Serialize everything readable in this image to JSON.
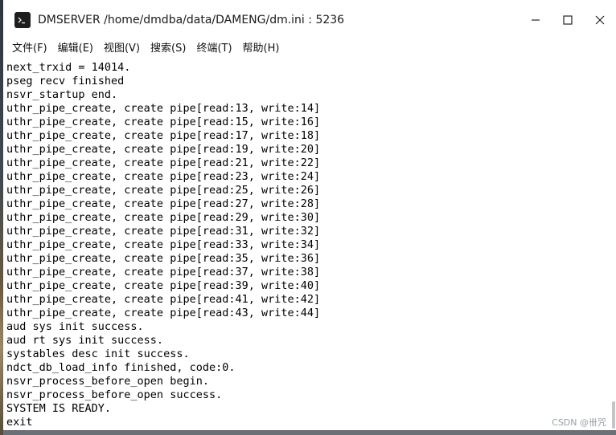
{
  "window": {
    "title": "DMSERVER /home/dmdba/data/DAMENG/dm.ini : 5236",
    "icon": "terminal-icon",
    "controls": {
      "minimize_icon": "minimize-icon",
      "maximize_icon": "maximize-icon",
      "close_icon": "close-icon"
    }
  },
  "menu": [
    {
      "label": "文件(F)"
    },
    {
      "label": "编辑(E)"
    },
    {
      "label": "视图(V)"
    },
    {
      "label": "搜索(S)"
    },
    {
      "label": "终端(T)"
    },
    {
      "label": "帮助(H)"
    }
  ],
  "terminal": {
    "lines": [
      "next_trxid = 14014.",
      "pseg recv finished",
      "nsvr_startup end.",
      "uthr_pipe_create, create pipe[read:13, write:14]",
      "uthr_pipe_create, create pipe[read:15, write:16]",
      "uthr_pipe_create, create pipe[read:17, write:18]",
      "uthr_pipe_create, create pipe[read:19, write:20]",
      "uthr_pipe_create, create pipe[read:21, write:22]",
      "uthr_pipe_create, create pipe[read:23, write:24]",
      "uthr_pipe_create, create pipe[read:25, write:26]",
      "uthr_pipe_create, create pipe[read:27, write:28]",
      "uthr_pipe_create, create pipe[read:29, write:30]",
      "uthr_pipe_create, create pipe[read:31, write:32]",
      "uthr_pipe_create, create pipe[read:33, write:34]",
      "uthr_pipe_create, create pipe[read:35, write:36]",
      "uthr_pipe_create, create pipe[read:37, write:38]",
      "uthr_pipe_create, create pipe[read:39, write:40]",
      "uthr_pipe_create, create pipe[read:41, write:42]",
      "uthr_pipe_create, create pipe[read:43, write:44]",
      "aud sys init success.",
      "aud rt sys init success.",
      "systables desc init success.",
      "ndct_db_load_info finished, code:0.",
      "nsvr_process_before_open begin.",
      "nsvr_process_before_open success.",
      "SYSTEM IS READY.",
      "exit"
    ]
  },
  "watermark": "CSDN @卌咒"
}
